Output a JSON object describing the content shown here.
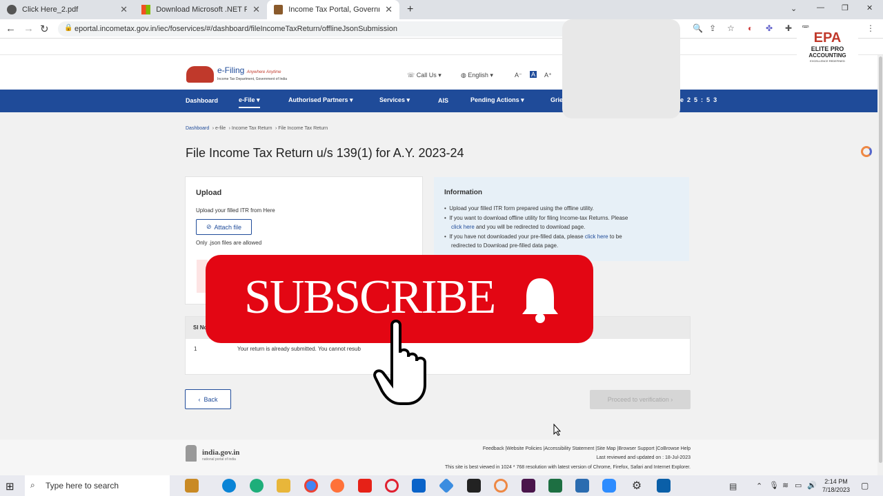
{
  "browser": {
    "tabs": [
      {
        "title": "Click Here_2.pdf",
        "active": false
      },
      {
        "title": "Download Microsoft .NET Frame",
        "active": false
      },
      {
        "title": "Income Tax Portal, Government o",
        "active": true
      }
    ],
    "url": "eportal.incometax.gov.in/iec/foservices/#/dashboard/fileIncomeTaxReturn/offlineJsonSubmission",
    "new_tab": "+",
    "win_controls": [
      "⌄",
      "—",
      "❐",
      "✕"
    ]
  },
  "overlay_logo": {
    "line1": "ELITE PRO",
    "line2": "ACCOUNTING",
    "line3": "EXCELLENCE REDEFINED",
    "mark": "EPA"
  },
  "site_header": {
    "logo_text": "e-Filing",
    "logo_tag": "Anywhere Anytime",
    "logo_sub": "Income Tax Department, Government of India",
    "call_us": "Call Us",
    "language": "English",
    "font_sizes": [
      "A⁻",
      "A",
      "A⁺"
    ]
  },
  "nav": {
    "items": [
      "Dashboard",
      "e-File",
      "Authorised Partners",
      "Services",
      "AIS",
      "Pending Actions",
      "Grie"
    ],
    "session_label": "e",
    "session_timer": [
      "2",
      "5",
      ":",
      "5",
      "3"
    ]
  },
  "breadcrumb": [
    "Dashboard",
    "e-file",
    "Income Tax Return",
    "File Income Tax Return"
  ],
  "page_title": "File Income Tax Return u/s 139(1) for A.Y. 2023-24",
  "upload": {
    "title": "Upload",
    "instruction": "Upload your filled ITR from Here",
    "attach_label": "Attach file",
    "note": "Only .json files are allowed"
  },
  "information": {
    "title": "Information",
    "bullet1": "Upload your filled ITR form prepared using the offline utility.",
    "bullet2_a": "If you want to download offline utility for filing Income-tax Returns. Please",
    "bullet2_link": "click here",
    "bullet2_b": "and you will be redirected to download page.",
    "bullet3_a": "If you have not downloaded your pre-filled data, please",
    "bullet3_link": "click here",
    "bullet3_b": "to be",
    "bullet3_c": "redirected to Download pre-filled data page."
  },
  "table": {
    "header_sl": "Sl No",
    "row_no": "1",
    "row_msg": "Your return is already submitted. You cannot resub"
  },
  "actions": {
    "back": "Back",
    "proceed": "Proceed to verification"
  },
  "subscribe": {
    "label": "SUBSCRIBE"
  },
  "footer": {
    "gov_logo": "india.gov.in",
    "gov_sub": "national portal of india",
    "links": "Feedback |Website Policies |Accessibility Statement |Site Map |Browser Support |CoBrowse Help",
    "updated": "Last reviewed and updated on : 18-Jul-2023",
    "best_viewed": "This site is best viewed in 1024 * 768 resolution with latest version of Chrome, Firefox, Safari and Internet Explorer."
  },
  "taskbar": {
    "search_placeholder": "Type here to search",
    "time": "2:14 PM",
    "date": "7/18/2023"
  },
  "colors": {
    "nav_blue": "#1f4b99",
    "subscribe_red": "#e30613",
    "info_bg": "#e7f0f7"
  }
}
